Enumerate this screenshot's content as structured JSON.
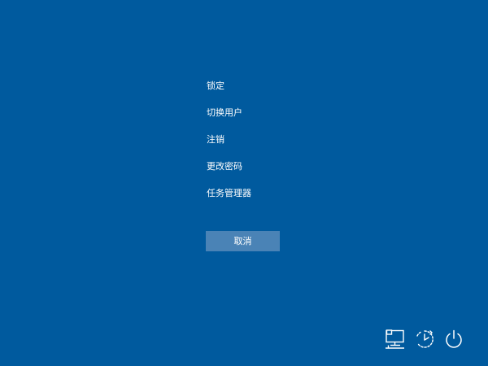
{
  "menu": {
    "items": [
      {
        "id": "lock",
        "label": "锁定"
      },
      {
        "id": "switch-user",
        "label": "切换用户"
      },
      {
        "id": "sign-out",
        "label": "注销"
      },
      {
        "id": "change-password",
        "label": "更改密码"
      },
      {
        "id": "task-manager",
        "label": "任务管理器"
      }
    ]
  },
  "cancel": {
    "label": "取消"
  },
  "tray": {
    "icons": [
      "network-icon",
      "ease-of-access-icon",
      "power-icon"
    ]
  },
  "colors": {
    "background": "#005a9e",
    "button": "#4a83b6",
    "text": "#ffffff"
  }
}
